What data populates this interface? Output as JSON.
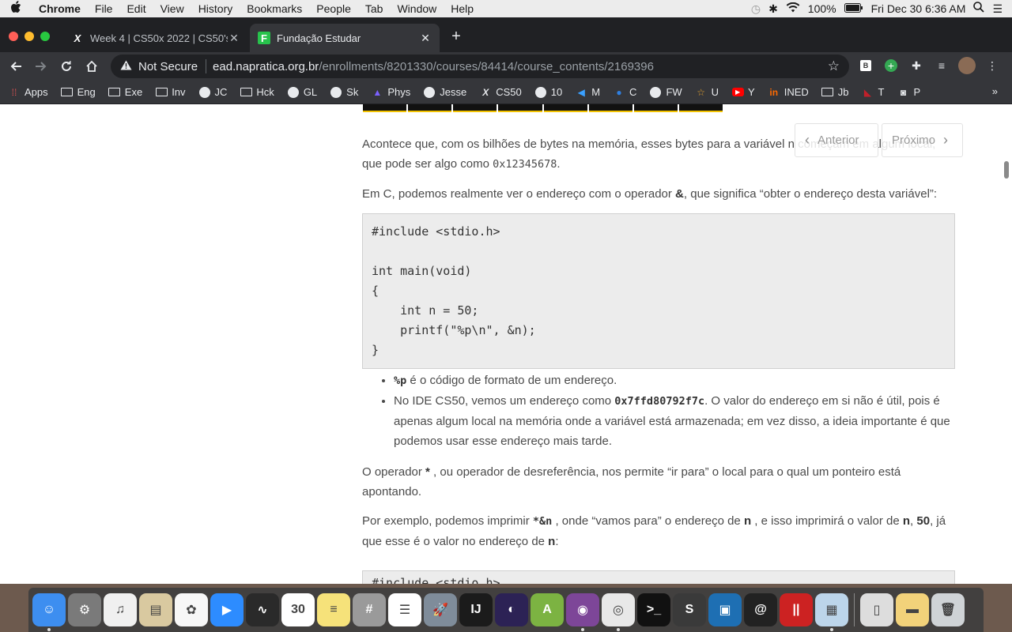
{
  "menubar": {
    "apple": "",
    "items": [
      "Chrome",
      "File",
      "Edit",
      "View",
      "History",
      "Bookmarks",
      "People",
      "Tab",
      "Window",
      "Help"
    ],
    "battery": "100%",
    "datetime": "Fri Dec 30  6:36 AM"
  },
  "tabs": [
    {
      "favicon": "X",
      "title": "Week 4 | CS50x 2022 | CS50's",
      "close": "✕"
    },
    {
      "favicon": "F",
      "title": "Fundação Estudar",
      "close": "✕"
    }
  ],
  "newtab": "+",
  "omnibox": {
    "security": "Not Secure",
    "host": "ead.napratica.org.br",
    "path": "/enrollments/8201330/courses/84414/course_contents/2169396"
  },
  "bookmarks": [
    {
      "label": "Apps",
      "icon": "apps-icon"
    },
    {
      "label": "Eng",
      "icon": "folder-icon"
    },
    {
      "label": "Exe",
      "icon": "folder-icon"
    },
    {
      "label": "Inv",
      "icon": "folder-icon"
    },
    {
      "label": "JC",
      "icon": "globe-icon"
    },
    {
      "label": "Hck",
      "icon": "folder-icon"
    },
    {
      "label": "GL",
      "icon": "globe-icon"
    },
    {
      "label": "Sk",
      "icon": "globe-icon"
    },
    {
      "label": "Phys",
      "icon": "phys-icon"
    },
    {
      "label": "Jesse",
      "icon": "globe-icon"
    },
    {
      "label": "CS50",
      "icon": "x-icon"
    },
    {
      "label": "10",
      "icon": "globe-icon"
    },
    {
      "label": "M",
      "icon": "m-icon"
    },
    {
      "label": "C",
      "icon": "c-icon"
    },
    {
      "label": "FW",
      "icon": "globe-icon"
    },
    {
      "label": "U",
      "icon": "u-icon"
    },
    {
      "label": "Y",
      "icon": "youtube-icon"
    },
    {
      "label": "INED",
      "icon": "ined-icon"
    },
    {
      "label": "Jb",
      "icon": "folder-icon"
    },
    {
      "label": "T",
      "icon": "t-icon"
    },
    {
      "label": "P",
      "icon": "p-icon"
    }
  ],
  "bookmarks_more": "»",
  "pagination": {
    "prev": "Anterior",
    "next": "Próximo"
  },
  "article": {
    "p1_a": "Acontece que, com os bilhões de bytes na memória, esses bytes para a variável n começam em algum local, que pode ser algo como ",
    "p1_code": "0x12345678",
    "p1_b": ".",
    "p2_a": "Em C, podemos realmente ver o endereço com o operador ",
    "p2_op": "&",
    "p2_b": ", que significa “obter o endereço desta variável”:",
    "code1": "#include <stdio.h>\n\nint main(void)\n{\n    int n = 50;\n    printf(\"%p\\n\", &n);\n}",
    "li1_code": "%p",
    "li1_text": " é o código de formato de um endereço.",
    "li2_a": "No IDE CS50, vemos um endereço como ",
    "li2_code": "0x7ffd80792f7c",
    "li2_b": ". O valor do endereço em si não é útil, pois é apenas algum local na memória onde a variável está armazenada; em vez disso, a ideia importante é que podemos usar esse endereço mais tarde.",
    "p3_a": "O operador ",
    "p3_op": "*",
    "p3_b": " , ou operador de desreferência, nos permite “ir para” o local para o qual um ponteiro está apontando.",
    "p4_a": "Por exemplo, podemos imprimir ",
    "p4_code": "*&n",
    "p4_b": " , onde “vamos para” o endereço de ",
    "p4_n1": "n",
    "p4_c": " , e isso imprimirá o valor de ",
    "p4_n2": "n",
    "p4_d": ", ",
    "p4_50": "50",
    "p4_e": ", já que esse é o valor no endereço de ",
    "p4_n3": "n",
    "p4_f": ":",
    "code2_peek": "#include <stdio.h>"
  },
  "dock": [
    {
      "name": "finder",
      "color": "#3d8ef0",
      "glyph": "☺",
      "dot": true
    },
    {
      "name": "system-preferences",
      "color": "#7a7a7a",
      "glyph": "⚙",
      "dot": false
    },
    {
      "name": "itunes",
      "color": "#f0f0f0",
      "glyph": "♫",
      "dot": false
    },
    {
      "name": "preview",
      "color": "#d9c9a0",
      "glyph": "▤",
      "dot": false
    },
    {
      "name": "photos",
      "color": "#f7f7f7",
      "glyph": "✿",
      "dot": false
    },
    {
      "name": "zoom",
      "color": "#2d8cff",
      "glyph": "▶",
      "dot": false
    },
    {
      "name": "activity-monitor",
      "color": "#2a2a2a",
      "glyph": "∿",
      "dot": false
    },
    {
      "name": "calendar",
      "color": "#ffffff",
      "glyph": "30",
      "dot": false
    },
    {
      "name": "notes",
      "color": "#f6e27a",
      "glyph": "≡",
      "dot": false
    },
    {
      "name": "calculator",
      "color": "#9a9a9a",
      "glyph": "#",
      "dot": false
    },
    {
      "name": "reminders",
      "color": "#ffffff",
      "glyph": "☰",
      "dot": false
    },
    {
      "name": "launchpad",
      "color": "#7f8c9a",
      "glyph": "🚀",
      "dot": false
    },
    {
      "name": "intellij",
      "color": "#1b1b1b",
      "glyph": "IJ",
      "dot": false
    },
    {
      "name": "eclipse",
      "color": "#2c2255",
      "glyph": "◐",
      "dot": false
    },
    {
      "name": "android-studio",
      "color": "#7cb342",
      "glyph": "A",
      "dot": false
    },
    {
      "name": "tor-browser",
      "color": "#7d4698",
      "glyph": "◉",
      "dot": true
    },
    {
      "name": "chrome",
      "color": "#e8e8e8",
      "glyph": "◎",
      "dot": true
    },
    {
      "name": "terminal",
      "color": "#111111",
      "glyph": ">_",
      "dot": false
    },
    {
      "name": "sublime-text",
      "color": "#3a3a3a",
      "glyph": "S",
      "dot": false
    },
    {
      "name": "virtualbox",
      "color": "#1e6fb3",
      "glyph": "▣",
      "dot": false
    },
    {
      "name": "debian",
      "color": "#222222",
      "glyph": "@",
      "dot": false
    },
    {
      "name": "parallels",
      "color": "#cc2222",
      "glyph": "||",
      "dot": false
    },
    {
      "name": "image-viewer",
      "color": "#bcd5ea",
      "glyph": "▦",
      "dot": true
    },
    {
      "name": "documents-stack",
      "color": "#dddddd",
      "glyph": "▯",
      "dot": false
    },
    {
      "name": "downloads-stack",
      "color": "#f2d27a",
      "glyph": "▬",
      "dot": false
    },
    {
      "name": "trash",
      "color": "#cfd3d6",
      "glyph": "🗑",
      "dot": false
    }
  ]
}
